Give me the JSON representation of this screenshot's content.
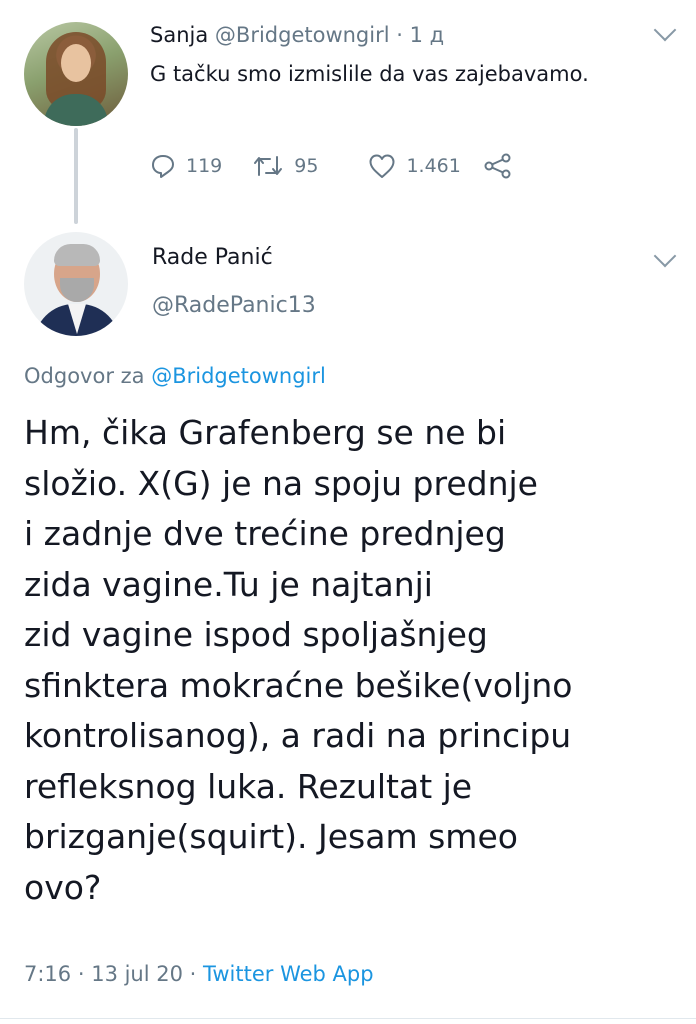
{
  "parent_tweet": {
    "name": "Sanja",
    "handle": "@Bridgetowngirl",
    "separator": " · ",
    "time": "1 д",
    "text": "G tačku smo izmislile da vas zajebavamo.",
    "replies": "119",
    "retweets": "95",
    "likes": "1.461"
  },
  "main_tweet": {
    "name": "Rade Panić",
    "handle": "@RadePanic13",
    "reply_prefix": "Odgovor za ",
    "reply_handle": "@Bridgetowngirl",
    "text_lines": [
      "Hm, čika Grafenberg se ne bi",
      "složio. X(G) je na spoju prednje",
      "i zadnje dve trećine prednjeg",
      "zida vagine.Tu je najtanji",
      "zid vagine ispod spoljašnjeg",
      "sfinktera mokraćne bešike(voljno",
      "kontrolisanog), a radi na principu",
      "refleksnog luka. Rezultat je",
      "brizganje(squirt). Jesam smeo",
      "ovo?"
    ],
    "time": "7:16",
    "date": "13 jul 20",
    "source": "Twitter Web App"
  },
  "colors": {
    "text": "#141823",
    "muted": "#657786",
    "link": "#1b95e0",
    "thread_line": "#cdd3d9"
  },
  "icons": [
    "reply-icon",
    "retweet-icon",
    "like-icon",
    "share-icon",
    "chevron-down-icon"
  ]
}
